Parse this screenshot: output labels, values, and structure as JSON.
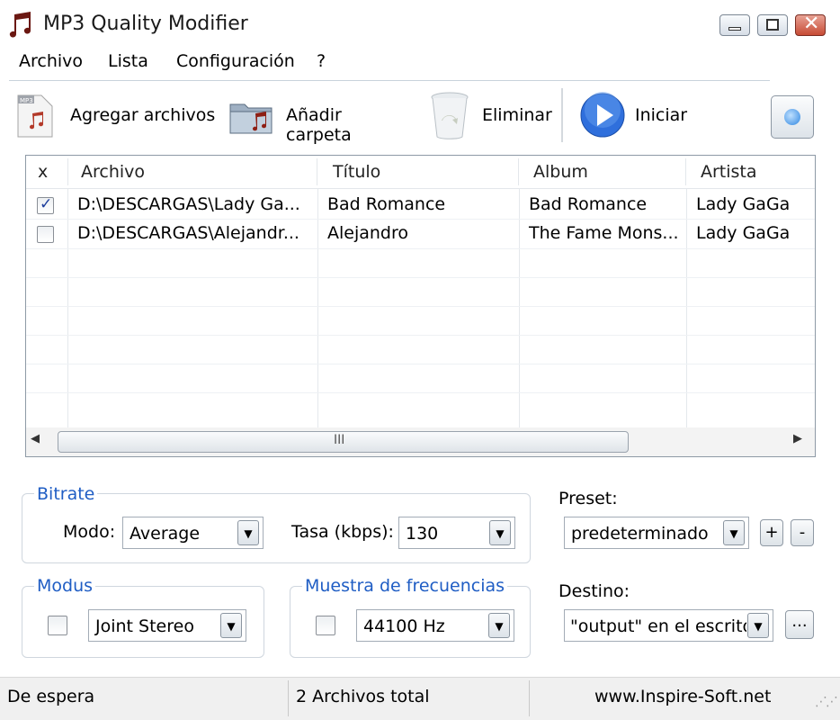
{
  "window": {
    "title": "MP3 Quality Modifier"
  },
  "menu": [
    "Archivo",
    "Lista",
    "Configuración",
    "?"
  ],
  "toolbar": {
    "add_files": "Agregar archivos",
    "add_folder": "Añadir carpeta",
    "remove": "Eliminar",
    "start": "Iniciar"
  },
  "table": {
    "headers": [
      "x",
      "Archivo",
      "Título",
      "Album",
      "Artista"
    ],
    "rows": [
      {
        "checked": true,
        "archivo": "D:\\DESCARGAS\\Lady Ga...",
        "titulo": "Bad Romance",
        "album": "Bad Romance",
        "artista": "Lady GaGa"
      },
      {
        "checked": false,
        "archivo": "D:\\DESCARGAS\\Alejandr...",
        "titulo": "Alejandro",
        "album": "The Fame Mons...",
        "artista": "Lady GaGa"
      }
    ],
    "scroll_grip": "III"
  },
  "bitrate": {
    "legend": "Bitrate",
    "mode_label": "Modo:",
    "mode_value": "Average",
    "rate_label": "Tasa (kbps):",
    "rate_value": "130"
  },
  "modus": {
    "legend": "Modus",
    "value": "Joint Stereo"
  },
  "sampling": {
    "legend": "Muestra de frecuencias",
    "value": "44100 Hz"
  },
  "preset": {
    "label": "Preset:",
    "value": "predeterminado",
    "add": "+",
    "remove": "-"
  },
  "destination": {
    "label": "Destino:",
    "value": "\"output\" en el escritor",
    "browse": "..."
  },
  "status": {
    "state": "De espera",
    "count": "2 Archivos total",
    "website": "www.Inspire-Soft.net"
  },
  "colors": {
    "legend": "#1f5dc4",
    "start_icon": "#2f6fdc"
  }
}
